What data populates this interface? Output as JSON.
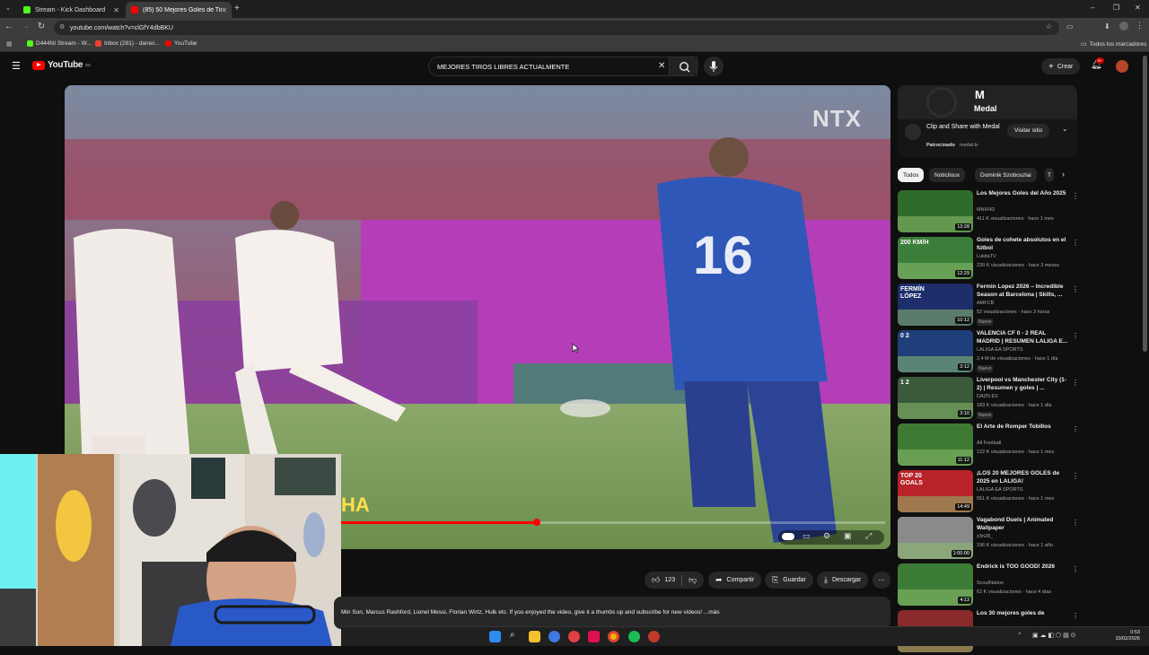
{
  "browser": {
    "tabs": [
      {
        "label": "Stream - Kick Dashboard",
        "color": "#53fc18"
      },
      {
        "label": "(85) 50 Mejores Goles de Tiro Libre",
        "color": "#ff0000"
      }
    ],
    "url": "youtube.com/watch?v=clGfY4dbBKU",
    "bookmarks": [
      "D444NI Stream - W...",
      "Inbox (281) - daniel...",
      "YouTube"
    ],
    "all_bookmarks_label": "Todos los marcadores"
  },
  "youtube": {
    "logo_text": "YouTube",
    "country_code": "ES",
    "search_query": "MEJORES TIROS LIBRES ACTUALMENTE",
    "create_label": "Crear",
    "notif_count": "9+"
  },
  "player": {
    "watermark": "NTX",
    "jersey_number": "16",
    "caption_fragment": "HA",
    "progress": 0.36
  },
  "actions": {
    "likes": "123",
    "share": "Compartir",
    "save": "Guardar",
    "download": "Descargar"
  },
  "description": "Min Son, Marcus Rashford, Lionel Messi, Florian Wirtz, Hulk etc. If you enjoyed the video, give it a thumbs up and subscribe for new videos! ...más",
  "ad": {
    "brand": "Medal",
    "headline": "Clip and Share with Medal",
    "sponsored": "Patrocinado",
    "domain": "medal.tv",
    "visit": "Visitar sitio"
  },
  "chips": [
    "Todos",
    "Noticiloux",
    "Dominik Szoboszlai",
    "T"
  ],
  "recommendations": [
    {
      "title": "Los Mejores Goles del Año 2025",
      "channel": "MNXHD",
      "meta": "411 K visualizaciones · hace 1 mes",
      "duration": "13:28",
      "badge": "",
      "thumb": "#2f6b2a"
    },
    {
      "title": "Goles de cohete absolutos en el fútbol",
      "channel": "LukitaTV",
      "meta": "239 K visualizaciones · hace 3 meses",
      "duration": "12:29",
      "badge": "",
      "thumb": "#3c7d3a",
      "overlay": "200 KM/H"
    },
    {
      "title": "Fermin Lopez 2026 – Incredible Season at Barcelona | Skills, ...",
      "channel": "AMFCB",
      "meta": "52 visualizaciones · hace 3 horas",
      "duration": "10:12",
      "badge": "Nuevo",
      "thumb": "#1d2e6b",
      "overlay": "FERMÍN LÓPEZ"
    },
    {
      "title": "VALENCIA CF 0 - 2 REAL MADRID | RESUMEN LALIGA E...",
      "channel": "LALIGA EA SPORTS",
      "meta": "2,4 M de visualizaciones · hace 1 día",
      "duration": "3:12",
      "badge": "Nuevo",
      "thumb": "#1e3f7a",
      "overlay": "0 2"
    },
    {
      "title": "Liverpool vs Manchester City (1-2) | Resumen y goles | ...",
      "channel": "DAZN ES",
      "meta": "183 K visualizaciones · hace 1 día",
      "duration": "3:10",
      "badge": "Nuevo",
      "thumb": "#3a5a3a",
      "overlay": "1 2"
    },
    {
      "title": "El Arte de Romper Tobillos",
      "channel": "All Football",
      "meta": "122 K visualizaciones · hace 1 mes",
      "duration": "11:12",
      "badge": "",
      "thumb": "#3f7a34"
    },
    {
      "title": "¡LOS 20 MEJORES GOLES de 2025 en LALIGA!",
      "channel": "LALIGA EA SPORTS",
      "meta": "551 K visualizaciones · hace 1 mes",
      "duration": "14:49",
      "badge": "",
      "thumb": "#b8242a",
      "overlay": "TOP 20 GOALS"
    },
    {
      "title": "Vagabond Duels | Animated Wallpaper",
      "channel": "z3n28_",
      "meta": "196 K visualizaciones · hace 1 año",
      "duration": "1:00:00",
      "badge": "",
      "thumb": "#8a8a8a"
    },
    {
      "title": "Endrick is TOO GOOD! 2026",
      "channel": "ScoutNation",
      "meta": "62 K visualizaciones · hace 4 días",
      "duration": "4:13",
      "badge": "",
      "thumb": "#3d7c37"
    },
    {
      "title": "Los 30 mejores goles de",
      "channel": "",
      "meta": "",
      "duration": "",
      "badge": "",
      "thumb": "#8a2a2a"
    }
  ],
  "clock": {
    "time": "0:53",
    "date": "10/02/2026"
  }
}
